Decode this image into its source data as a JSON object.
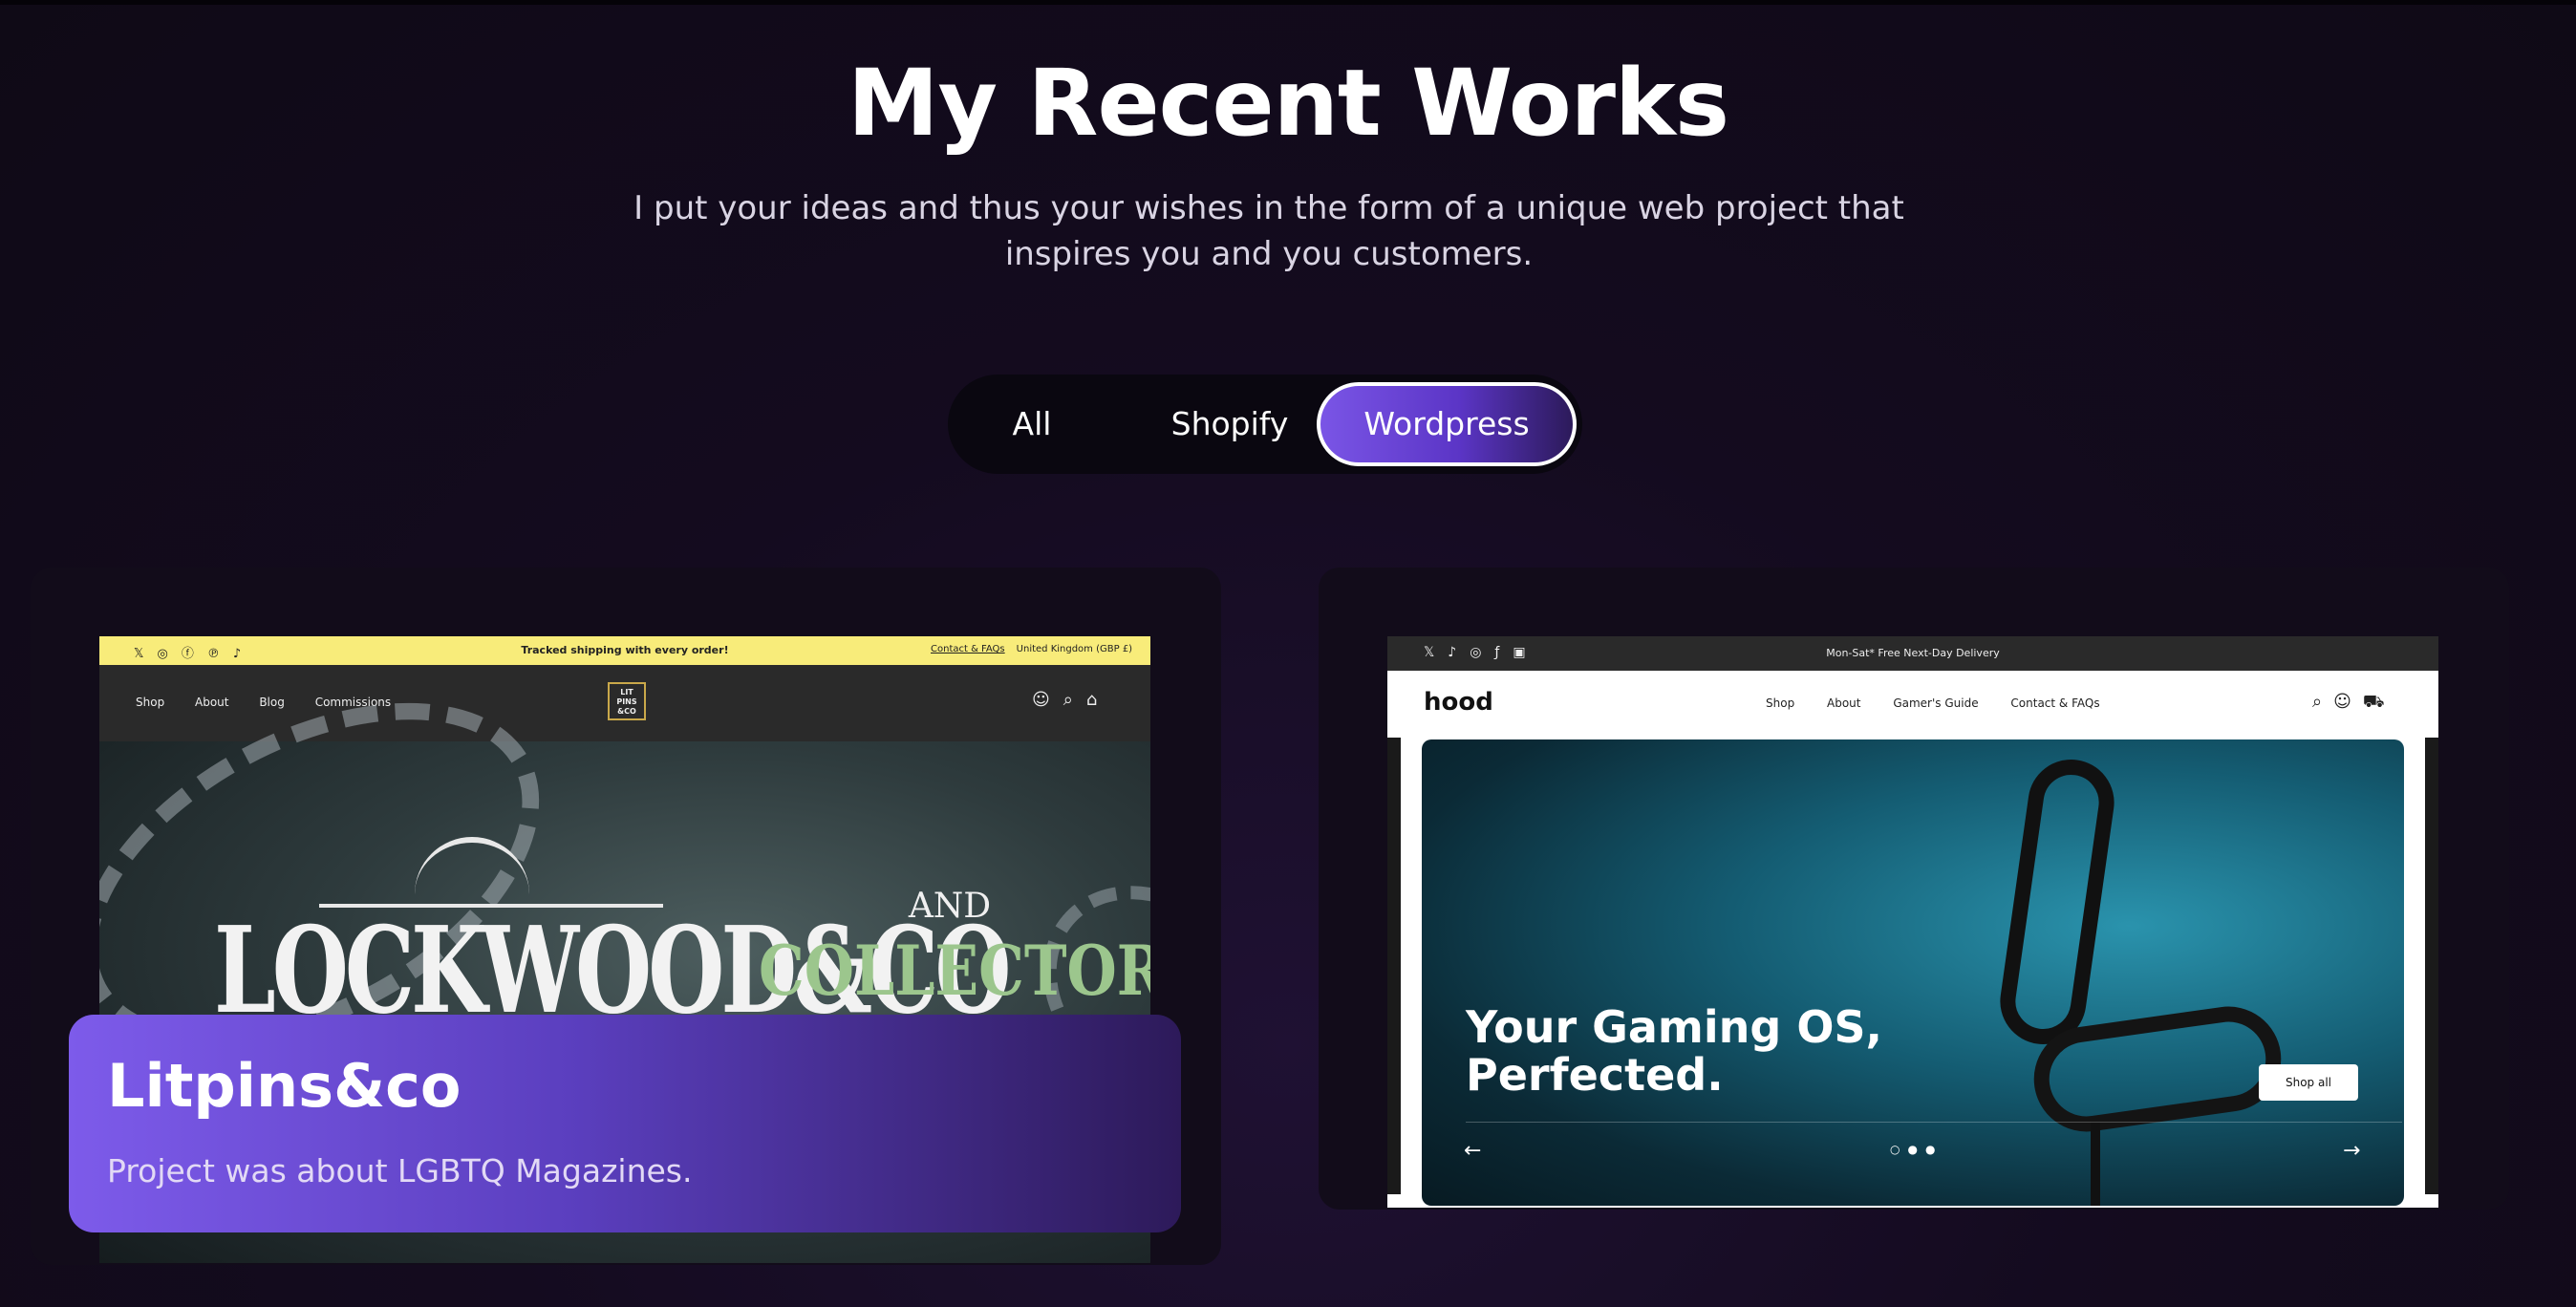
{
  "header": {
    "title": "My Recent Works",
    "subtitle": "I put your ideas and thus your wishes in the form of a unique web project that inspires you and you customers."
  },
  "filters": {
    "tabs": [
      {
        "label": "All",
        "active": false
      },
      {
        "label": "Shopify",
        "active": false
      },
      {
        "label": "Wordpress",
        "active": true
      }
    ],
    "accent_color": "#7a55e6"
  },
  "projects": [
    {
      "name": "Litpins&co",
      "description": "Project was about LGBTQ Magazines.",
      "screenshot": {
        "announcement": "Tracked shipping with every order!",
        "announcement_link": "Contact & FAQs",
        "region": "United Kingdom (GBP £)",
        "nav": [
          "Shop",
          "About",
          "Blog",
          "Commissions"
        ],
        "logo_text": "LIT PINS &CO",
        "hero_title": "LOCKWOOD&CO",
        "hero_and": "AND",
        "hero_collectors": "COLLECTOR'S"
      }
    },
    {
      "screenshot": {
        "announcement": "Mon-Sat* Free Next-Day Delivery",
        "logo": "hood",
        "nav": [
          "Shop",
          "About",
          "Gamer's Guide",
          "Contact & FAQs"
        ],
        "hero_title_line1": "Your Gaming OS,",
        "hero_title_line2": "Perfected.",
        "cta": "Shop all"
      }
    }
  ]
}
